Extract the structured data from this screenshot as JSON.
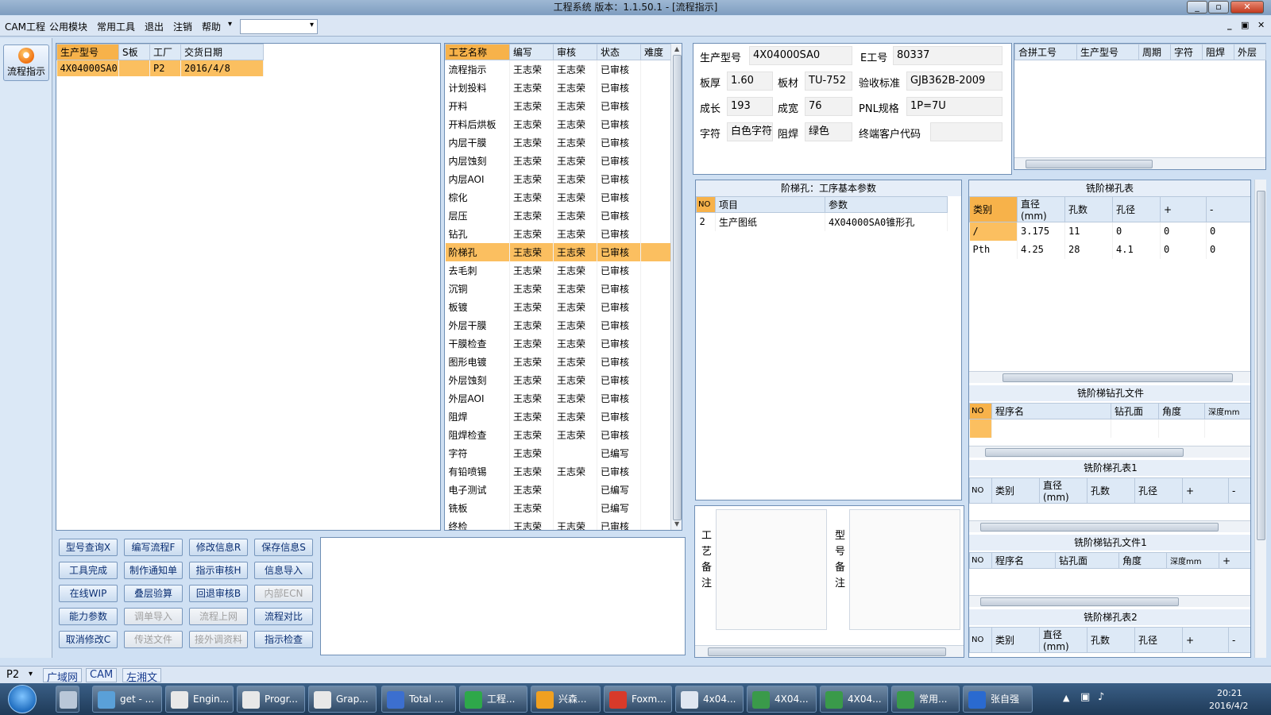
{
  "window": {
    "title": "工程系统  版本：1.1.50.1 - [流程指示]",
    "min": "_",
    "max": "▫",
    "close": "✕"
  },
  "menu": {
    "items": [
      "CAM工程",
      "公用模块",
      "常用工具",
      "退出",
      "注销",
      "帮助"
    ],
    "help_arrow": "▾",
    "combo_value": "",
    "combo_arrow": "▾",
    "mdi_min": "_",
    "mdi_restore": "▣",
    "mdi_close": "✕"
  },
  "left_panel": {
    "flow_button": "流程指示"
  },
  "order_grid": {
    "columns": [
      "生产型号",
      "S板",
      "工厂",
      "交货日期"
    ],
    "rows": [
      {
        "model": "4X04000SA0",
        "s": "",
        "factory": "P2",
        "date": "2016/4/8"
      }
    ]
  },
  "process_grid": {
    "columns": [
      "工艺名称",
      "编写",
      "审核",
      "状态",
      "难度"
    ],
    "rows": [
      [
        "流程指示",
        "王志荣",
        "王志荣",
        "已审核",
        ""
      ],
      [
        "计划投料",
        "王志荣",
        "王志荣",
        "已审核",
        ""
      ],
      [
        "开料",
        "王志荣",
        "王志荣",
        "已审核",
        ""
      ],
      [
        "开料后烘板",
        "王志荣",
        "王志荣",
        "已审核",
        ""
      ],
      [
        "内层干膜",
        "王志荣",
        "王志荣",
        "已审核",
        ""
      ],
      [
        "内层蚀刻",
        "王志荣",
        "王志荣",
        "已审核",
        ""
      ],
      [
        "内层AOI",
        "王志荣",
        "王志荣",
        "已审核",
        ""
      ],
      [
        "棕化",
        "王志荣",
        "王志荣",
        "已审核",
        ""
      ],
      [
        "层压",
        "王志荣",
        "王志荣",
        "已审核",
        ""
      ],
      [
        "钻孔",
        "王志荣",
        "王志荣",
        "已审核",
        ""
      ],
      [
        "阶梯孔",
        "王志荣",
        "王志荣",
        "已审核",
        ""
      ],
      [
        "去毛刺",
        "王志荣",
        "王志荣",
        "已审核",
        ""
      ],
      [
        "沉铜",
        "王志荣",
        "王志荣",
        "已审核",
        ""
      ],
      [
        "板镀",
        "王志荣",
        "王志荣",
        "已审核",
        ""
      ],
      [
        "外层干膜",
        "王志荣",
        "王志荣",
        "已审核",
        ""
      ],
      [
        "干膜检查",
        "王志荣",
        "王志荣",
        "已审核",
        ""
      ],
      [
        "图形电镀",
        "王志荣",
        "王志荣",
        "已审核",
        ""
      ],
      [
        "外层蚀刻",
        "王志荣",
        "王志荣",
        "已审核",
        ""
      ],
      [
        "外层AOI",
        "王志荣",
        "王志荣",
        "已审核",
        ""
      ],
      [
        "阻焊",
        "王志荣",
        "王志荣",
        "已审核",
        ""
      ],
      [
        "阻焊检查",
        "王志荣",
        "王志荣",
        "已审核",
        ""
      ],
      [
        "字符",
        "王志荣",
        "",
        "已编写",
        ""
      ],
      [
        "有铅喷锡",
        "王志荣",
        "王志荣",
        "已审核",
        ""
      ],
      [
        "电子测试",
        "王志荣",
        "",
        "已编写",
        ""
      ],
      [
        "铣板",
        "王志荣",
        "",
        "已编写",
        ""
      ],
      [
        "终检",
        "王志荣",
        "王志荣",
        "已审核",
        ""
      ]
    ],
    "selected_index": 10
  },
  "buttons": [
    {
      "label": "型号查询X",
      "enabled": true
    },
    {
      "label": "编写流程F",
      "enabled": true
    },
    {
      "label": "修改信息R",
      "enabled": true
    },
    {
      "label": "保存信息S",
      "enabled": true
    },
    {
      "label": "工具完成",
      "enabled": true
    },
    {
      "label": "制作通知单",
      "enabled": true
    },
    {
      "label": "指示审核H",
      "enabled": true
    },
    {
      "label": "信息导入",
      "enabled": true
    },
    {
      "label": "在线WIP",
      "enabled": true
    },
    {
      "label": "叠层验算",
      "enabled": true
    },
    {
      "label": "回退审核B",
      "enabled": true
    },
    {
      "label": "内部ECN",
      "enabled": false
    },
    {
      "label": "能力参数",
      "enabled": true
    },
    {
      "label": "调单导入",
      "enabled": false
    },
    {
      "label": "流程上网",
      "enabled": false
    },
    {
      "label": "流程对比",
      "enabled": true
    },
    {
      "label": "取消修改C",
      "enabled": true
    },
    {
      "label": "传送文件",
      "enabled": false
    },
    {
      "label": "接外调资料",
      "enabled": false
    },
    {
      "label": "指示检查",
      "enabled": true
    }
  ],
  "info": {
    "model_label": "生产型号",
    "model": "4X04000SA0",
    "eno_label": "E工号",
    "eno": "80337",
    "thickness_label": "板厚",
    "thickness": "1.60",
    "material_label": "板材",
    "material": "TU-752",
    "standard_label": "验收标准",
    "standard": "GJB362B-2009",
    "length_label": "成长",
    "length": "193",
    "width_label": "成宽",
    "width": "76",
    "pnl_label": "PNL规格",
    "pnl": "1P=7U",
    "char_label": "字符",
    "char": "白色字符",
    "mask_label": "阻焊",
    "mask": "绿色",
    "customer_label": "终端客户代码",
    "customer": ""
  },
  "combined_grid": {
    "columns": [
      "合拼工号",
      "生产型号",
      "周期",
      "字符",
      "阻焊",
      "外层"
    ]
  },
  "step_params": {
    "title": "阶梯孔：工序基本参数",
    "columns": [
      "NO",
      "项目",
      "参数"
    ],
    "rows": [
      {
        "no": "2",
        "item": "生产图纸",
        "param": "4X04000SA0锥形孔"
      }
    ]
  },
  "remarks": {
    "process_label": "工艺备注",
    "model_label": "型号备注"
  },
  "mill_table": {
    "title": "铣阶梯孔表",
    "columns": [
      "类别",
      "直径(mm)",
      "孔数",
      "孔径",
      "+",
      "-"
    ],
    "rows": [
      [
        "/",
        "3.175",
        "11",
        "0",
        "0",
        "0"
      ],
      [
        "Pth",
        "4.25",
        "28",
        "4.1",
        "0",
        "0"
      ]
    ]
  },
  "mill_drill_file": {
    "title": "铣阶梯钻孔文件",
    "columns": [
      "NO",
      "程序名",
      "钻孔面",
      "角度",
      "深度mm"
    ]
  },
  "mill_table1": {
    "title": "铣阶梯孔表1",
    "columns": [
      "NO",
      "类别",
      "直径(mm)",
      "孔数",
      "孔径",
      "+",
      "-"
    ]
  },
  "mill_drill_file1": {
    "title": "铣阶梯钻孔文件1",
    "columns": [
      "NO",
      "程序名",
      "钻孔面",
      "角度",
      "深度mm",
      "+"
    ]
  },
  "mill_table2": {
    "title": "铣阶梯孔表2",
    "columns": [
      "NO",
      "类别",
      "直径(mm)",
      "孔数",
      "孔径",
      "+",
      "-"
    ]
  },
  "statusbar": {
    "factory": "P2",
    "factory_arrow": "▾",
    "tabs": [
      "广域网",
      "CAM",
      "左湘文"
    ]
  },
  "taskbar": {
    "tasks": [
      {
        "label": "",
        "color": "#b9c7d8"
      },
      {
        "label": "get - ...",
        "color": "#5aa0d8"
      },
      {
        "label": "Engin...",
        "color": "#e8e8e8"
      },
      {
        "label": "Progr...",
        "color": "#e8e8e8"
      },
      {
        "label": "Grap...",
        "color": "#e8e8e8"
      },
      {
        "label": "Total ...",
        "color": "#3c6fcf"
      },
      {
        "label": "工程...",
        "color": "#2ea84a"
      },
      {
        "label": "兴森...",
        "color": "#f0a020"
      },
      {
        "label": "Foxm...",
        "color": "#d83a2a"
      },
      {
        "label": "4x04...",
        "color": "#dfe6f0"
      },
      {
        "label": "4X04...",
        "color": "#3a9a4a"
      },
      {
        "label": "4X04...",
        "color": "#3a9a4a"
      },
      {
        "label": "常用...",
        "color": "#3a9a4a"
      },
      {
        "label": "张自强",
        "color": "#2a6ad0"
      }
    ],
    "time": "20:21",
    "date": "2016/4/2"
  }
}
